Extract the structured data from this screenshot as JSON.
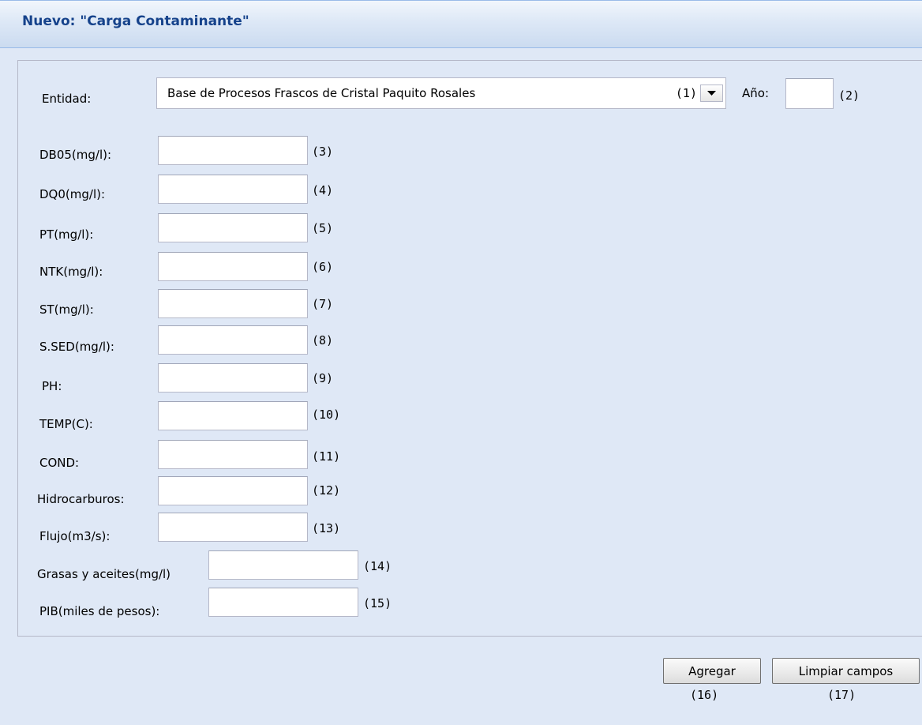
{
  "panel": {
    "title": "Nuevo: \"Carga Contaminante\""
  },
  "entity": {
    "label": "Entidad:",
    "selected_value": "Base de Procesos Frascos de Cristal Paquito Rosales",
    "code": "(1)"
  },
  "year": {
    "label": "Año:",
    "value": "",
    "code": "(2)"
  },
  "fields": [
    {
      "label": "DB05(mg/l):",
      "value": "",
      "code": "(3)"
    },
    {
      "label": "DQ0(mg/l):",
      "value": "",
      "code": "(4)"
    },
    {
      "label": "PT(mg/l):",
      "value": "",
      "code": "(5)"
    },
    {
      "label": "NTK(mg/l):",
      "value": "",
      "code": "(6)"
    },
    {
      "label": "ST(mg/l):",
      "value": "",
      "code": "(7)"
    },
    {
      "label": "S.SED(mg/l):",
      "value": "",
      "code": "(8)"
    },
    {
      "label": "PH:",
      "value": "",
      "code": "(9)"
    },
    {
      "label": "TEMP(C):",
      "value": "",
      "code": "(10)"
    },
    {
      "label": "COND:",
      "value": "",
      "code": "(11)"
    },
    {
      "label": "Hidrocarburos:",
      "value": "",
      "code": "(12)"
    },
    {
      "label": "Flujo(m3/s):",
      "value": "",
      "code": "(13)"
    },
    {
      "label": "Grasas y aceites(mg/l)",
      "value": "",
      "code": "(14)"
    },
    {
      "label": "PIB(miles de pesos):",
      "value": "",
      "code": "(15)"
    }
  ],
  "actions": {
    "add_label": "Agregar",
    "add_code": "(16)",
    "clear_label": "Limpiar campos",
    "clear_code": "(17)"
  }
}
